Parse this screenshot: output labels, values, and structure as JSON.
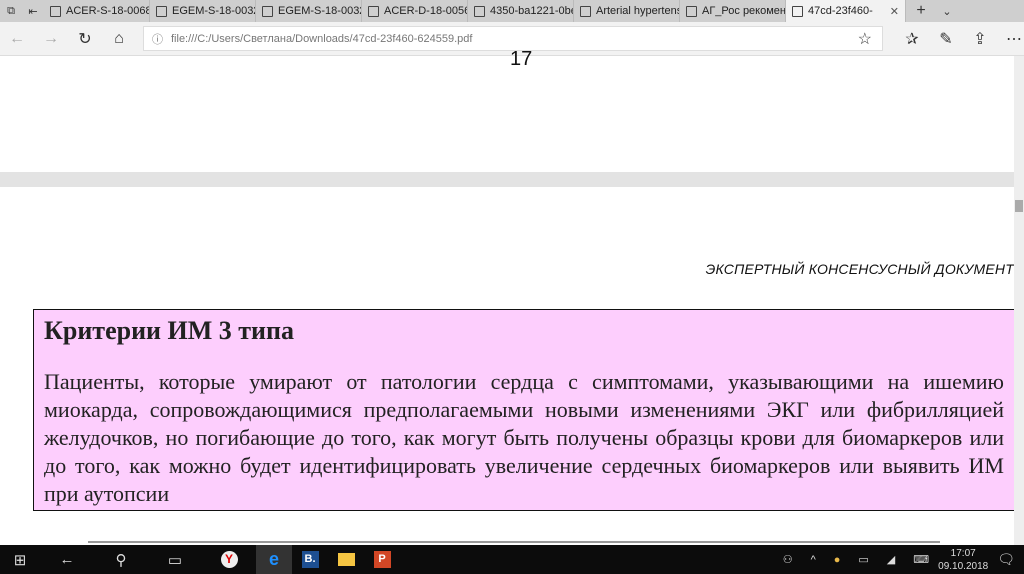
{
  "tabs": [
    {
      "label": "ACER-S-18-00689"
    },
    {
      "label": "EGEM-S-18-0032"
    },
    {
      "label": "EGEM-S-18-0032"
    },
    {
      "label": "ACER-D-18-0056"
    },
    {
      "label": "4350-ba1221-0be"
    },
    {
      "label": "Arterial hypertens"
    },
    {
      "label": "АГ_Рос рекомен"
    },
    {
      "label": "47cd-23f460-",
      "active": true
    }
  ],
  "address": {
    "url": "file:///C:/Users/Светлана/Downloads/47cd-23f460-624559.pdf"
  },
  "pdf": {
    "page_number": "17",
    "running_header": "ЭКСПЕРТНЫЙ КОНСЕНСУСНЫЙ ДОКУМЕНТ",
    "box_title": "Критерии ИМ 3 типа",
    "box_text": "Пациенты, которые умирают от патологии сердца с симптомами, указывающими на ишемию миокарда, сопровождающимися предполагаемыми новыми изменениями ЭКГ или фибрилляцией желудочков, но погибающие до того, как могут быть получены образцы крови для биомаркеров или до того, как можно будет идентифицировать увеличение сердечных биомаркеров или выявить ИМ при аутопсии",
    "box_color": "#fdcefd"
  },
  "taskbar": {
    "time": "17:07",
    "date": "09.10.2018"
  }
}
